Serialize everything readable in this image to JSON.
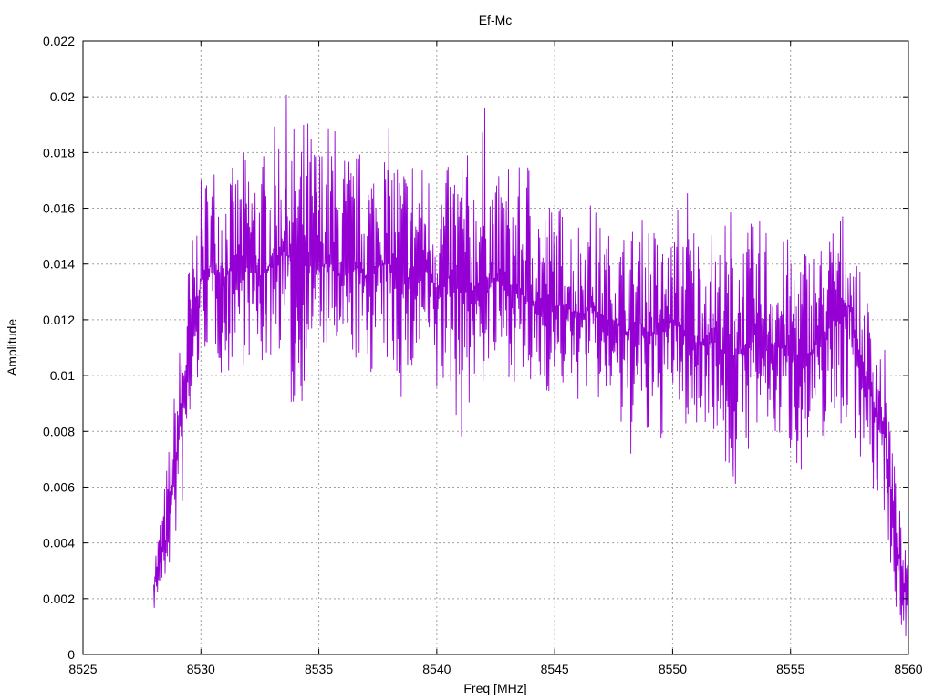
{
  "chart_data": {
    "type": "line",
    "title": "Ef-Mc",
    "xlabel": "Freq [MHz]",
    "ylabel": "Amplitude",
    "xlim": [
      8525,
      8560
    ],
    "ylim": [
      0,
      0.022
    ],
    "xticks": [
      8525,
      8530,
      8535,
      8540,
      8545,
      8550,
      8555,
      8560
    ],
    "xtick_labels": [
      "8525",
      "8530",
      "8535",
      "8540",
      "8545",
      "8550",
      "8555",
      "8560"
    ],
    "yticks": [
      0,
      0.002,
      0.004,
      0.006,
      0.008,
      0.01,
      0.012,
      0.014,
      0.016,
      0.018,
      0.02,
      0.022
    ],
    "ytick_labels": [
      "0",
      "0.002",
      "0.004",
      "0.006",
      "0.008",
      "0.01",
      "0.012",
      "0.014",
      "0.016",
      "0.018",
      "0.02",
      "0.022"
    ],
    "grid": true,
    "legend": "none",
    "series_color": "#9400d3",
    "series": [
      {
        "x": [
          8528.0,
          8528.5,
          8529.0,
          8529.5,
          8530.0,
          8530.5,
          8531.0,
          8531.5,
          8532.0,
          8532.5,
          8533.0,
          8533.5,
          8534.0,
          8534.5,
          8535.0,
          8535.5,
          8536.0,
          8536.5,
          8537.0,
          8537.5,
          8538.0,
          8538.5,
          8539.0,
          8539.5,
          8540.0,
          8540.5,
          8541.0,
          8541.5,
          8542.0,
          8542.5,
          8543.0,
          8543.5,
          8544.0,
          8544.5,
          8545.0,
          8545.5,
          8546.0,
          8546.5,
          8547.0,
          8547.5,
          8548.0,
          8548.5,
          8549.0,
          8549.5,
          8550.0,
          8550.5,
          8551.0,
          8551.5,
          8552.0,
          8552.5,
          8553.0,
          8553.5,
          8554.0,
          8554.5,
          8555.0,
          8555.5,
          8556.0,
          8556.5,
          8557.0,
          8557.5,
          8558.0,
          8558.5,
          8559.0,
          8559.5,
          8560.0
        ],
        "y_low": [
          0.0015,
          0.0025,
          0.004,
          0.0065,
          0.0105,
          0.011,
          0.0095,
          0.01,
          0.0105,
          0.01,
          0.0105,
          0.011,
          0.007,
          0.0105,
          0.011,
          0.0105,
          0.01,
          0.0105,
          0.0095,
          0.0105,
          0.01,
          0.009,
          0.0095,
          0.0105,
          0.0085,
          0.0095,
          0.0075,
          0.009,
          0.0095,
          0.01,
          0.01,
          0.0095,
          0.009,
          0.0095,
          0.009,
          0.0095,
          0.009,
          0.0095,
          0.0085,
          0.009,
          0.0065,
          0.0075,
          0.007,
          0.0075,
          0.009,
          0.008,
          0.0075,
          0.0085,
          0.0075,
          0.005,
          0.007,
          0.0075,
          0.0075,
          0.0075,
          0.007,
          0.0065,
          0.007,
          0.0075,
          0.008,
          0.008,
          0.007,
          0.0055,
          0.005,
          0.001,
          0.0005
        ],
        "y_mid": [
          0.0025,
          0.004,
          0.0075,
          0.0105,
          0.0135,
          0.014,
          0.0135,
          0.014,
          0.014,
          0.0135,
          0.014,
          0.0145,
          0.014,
          0.014,
          0.014,
          0.014,
          0.0135,
          0.014,
          0.0135,
          0.014,
          0.014,
          0.0135,
          0.0135,
          0.014,
          0.013,
          0.0135,
          0.013,
          0.013,
          0.0135,
          0.0135,
          0.013,
          0.013,
          0.0125,
          0.0125,
          0.0125,
          0.0125,
          0.012,
          0.0125,
          0.012,
          0.012,
          0.0115,
          0.012,
          0.0115,
          0.0115,
          0.012,
          0.0115,
          0.011,
          0.0115,
          0.011,
          0.0105,
          0.011,
          0.0115,
          0.011,
          0.011,
          0.011,
          0.0105,
          0.011,
          0.0115,
          0.0125,
          0.0125,
          0.0105,
          0.009,
          0.008,
          0.004,
          0.0015
        ],
        "y_high": [
          0.0035,
          0.0065,
          0.0105,
          0.0145,
          0.017,
          0.018,
          0.0175,
          0.0175,
          0.0185,
          0.018,
          0.0185,
          0.0205,
          0.019,
          0.0195,
          0.0185,
          0.0195,
          0.0185,
          0.018,
          0.0185,
          0.018,
          0.019,
          0.018,
          0.0185,
          0.0175,
          0.018,
          0.0175,
          0.019,
          0.0175,
          0.02,
          0.017,
          0.018,
          0.0175,
          0.0185,
          0.0165,
          0.0165,
          0.016,
          0.016,
          0.0165,
          0.0155,
          0.015,
          0.0155,
          0.0155,
          0.016,
          0.015,
          0.015,
          0.018,
          0.0155,
          0.0155,
          0.015,
          0.0165,
          0.0155,
          0.0155,
          0.016,
          0.015,
          0.015,
          0.015,
          0.015,
          0.015,
          0.0163,
          0.0155,
          0.0135,
          0.0125,
          0.011,
          0.006,
          0.003
        ]
      }
    ]
  }
}
